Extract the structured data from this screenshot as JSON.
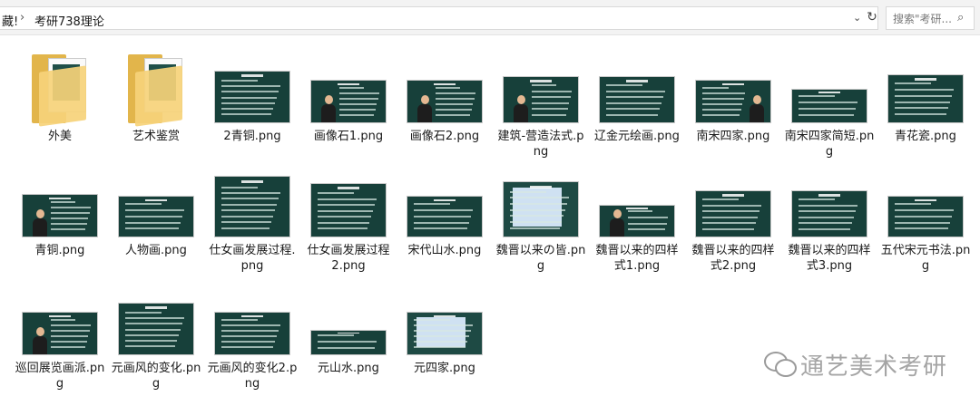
{
  "address": {
    "prev_crumb": "藏!",
    "separator": "›",
    "current_crumb": "考研738理论",
    "dropdown": "⌄",
    "refresh": "↻"
  },
  "search": {
    "placeholder": "搜索\"考研...",
    "icon": "search-icon"
  },
  "items": [
    {
      "label": "外美",
      "type": "folder"
    },
    {
      "label": "艺术鉴赏",
      "type": "folder"
    },
    {
      "label": "2青铜.png",
      "type": "image"
    },
    {
      "label": "画像石1.png",
      "type": "image"
    },
    {
      "label": "画像石2.png",
      "type": "image"
    },
    {
      "label": "建筑-营造法式.png",
      "type": "image"
    },
    {
      "label": "辽金元绘画.png",
      "type": "image"
    },
    {
      "label": "南宋四家.png",
      "type": "image"
    },
    {
      "label": "南宋四家简短.png",
      "type": "image"
    },
    {
      "label": "青花瓷.png",
      "type": "image"
    },
    {
      "label": "青铜.png",
      "type": "image"
    },
    {
      "label": "人物画.png",
      "type": "image"
    },
    {
      "label": "仕女画发展过程.png",
      "type": "image"
    },
    {
      "label": "仕女画发展过程2.png",
      "type": "image"
    },
    {
      "label": "宋代山水.png",
      "type": "image"
    },
    {
      "label": "魏晋以来の皆.png",
      "type": "image"
    },
    {
      "label": "魏晋以来的四样式1.png",
      "type": "image"
    },
    {
      "label": "魏晋以来的四样式2.png",
      "type": "image"
    },
    {
      "label": "魏晋以来的四样式3.png",
      "type": "image"
    },
    {
      "label": "五代宋元书法.png",
      "type": "image"
    },
    {
      "label": "巡回展览画派.png",
      "type": "image"
    },
    {
      "label": "元画风的变化.png",
      "type": "image"
    },
    {
      "label": "元画风的变化2.png",
      "type": "image"
    },
    {
      "label": "元山水.png",
      "type": "image"
    },
    {
      "label": "元四家.png",
      "type": "image"
    }
  ],
  "watermark": {
    "text": "通艺美术考研"
  }
}
